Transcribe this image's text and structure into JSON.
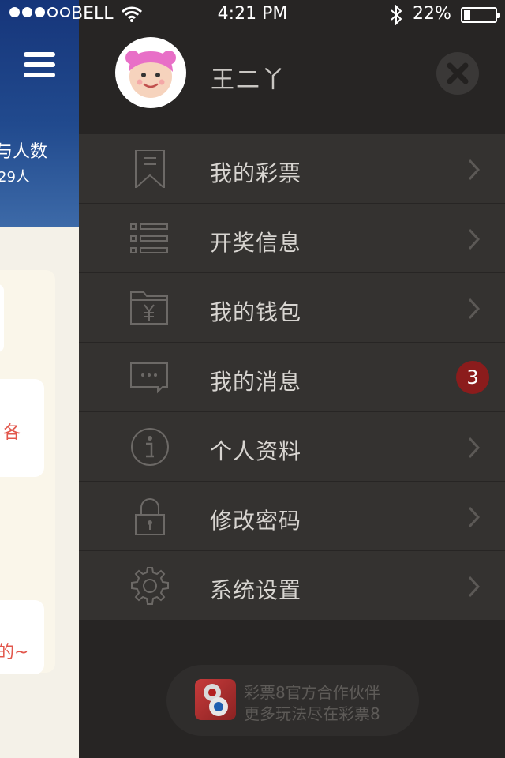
{
  "status_bar": {
    "carrier": "BELL",
    "time": "4:21 PM",
    "battery_percent": "22%",
    "battery_level": 0.22,
    "signal_bars": 3
  },
  "background_page": {
    "title_fragment": "与人数",
    "count_fragment": "29人",
    "card_text_1": "各",
    "card_text_2": "的~"
  },
  "drawer": {
    "user": {
      "name": "王二丫"
    },
    "menu": [
      {
        "label": "我的彩票",
        "icon": "bookmark-icon"
      },
      {
        "label": "开奖信息",
        "icon": "list-icon"
      },
      {
        "label": "我的钱包",
        "icon": "wallet-folder-icon"
      },
      {
        "label": "我的消息",
        "icon": "message-icon",
        "badge": "3"
      },
      {
        "label": "个人资料",
        "icon": "info-icon"
      },
      {
        "label": "修改密码",
        "icon": "lock-icon"
      },
      {
        "label": "系统设置",
        "icon": "gear-icon"
      }
    ],
    "partner": {
      "line1": "彩票8官方合作伙伴",
      "line2": "更多玩法尽在彩票8"
    }
  },
  "colors": {
    "drawer_bg": "#272524",
    "menu_bg": "#343230",
    "badge": "#8b1c1c",
    "header_blue": "#1e4388",
    "accent_red": "#e2574c"
  }
}
